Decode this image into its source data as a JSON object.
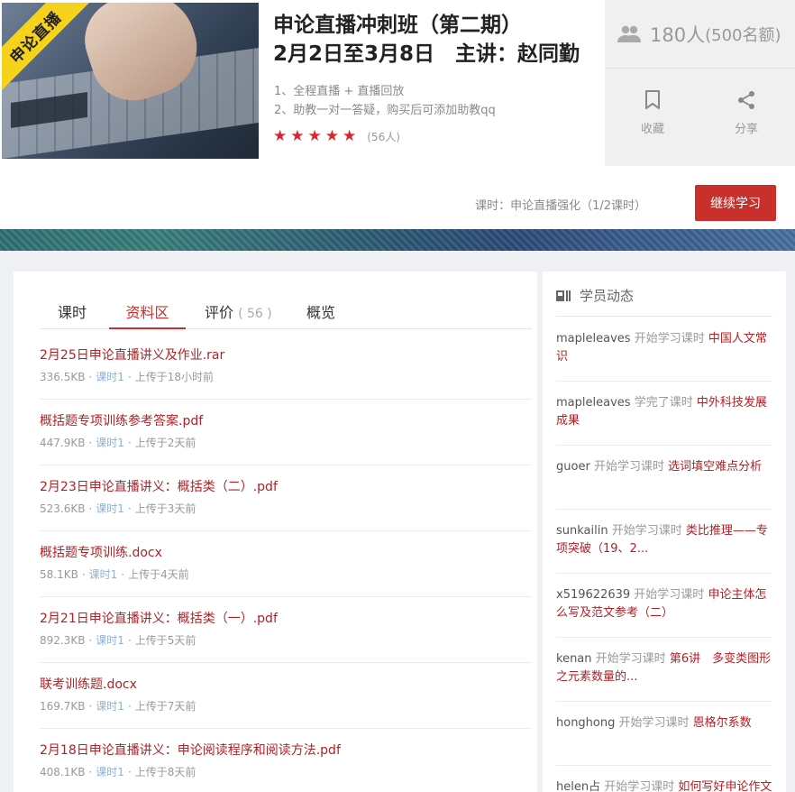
{
  "course": {
    "ribbon": "申论直播",
    "title_line1": "申论直播冲刺班（第二期）",
    "title_line2": "2月2日至3月8日　主讲：赵同勤",
    "features": [
      "1、全程直播 + 直播回放",
      "2、助教一对一答疑，购买后可添加助教qq"
    ],
    "rating_stars": 5,
    "rating_count": "(56人)",
    "enrolled": "180人",
    "quota": "(500名额)",
    "favorite_label": "收藏",
    "share_label": "分享"
  },
  "progress": {
    "text": "课时：申论直播强化（1/2课时）",
    "continue_label": "继续学习"
  },
  "colors": {
    "accent": "#c9302c",
    "link": "#b32025",
    "star": "#d9272d",
    "ribbon": "#f6d21c"
  },
  "tabs": [
    {
      "label": "课时"
    },
    {
      "label": "资料区"
    },
    {
      "label": "评价",
      "count": "( 56 )"
    },
    {
      "label": "概览"
    }
  ],
  "files": [
    {
      "name": "2月25日申论直播讲义及作业.rar",
      "size": "336.5KB",
      "lesson": "课时1",
      "uploaded": "上传于18小时前"
    },
    {
      "name": "概括题专项训练参考答案.pdf",
      "size": "447.9KB",
      "lesson": "课时1",
      "uploaded": "上传于2天前"
    },
    {
      "name": "2月23日申论直播讲义：概括类（二）.pdf",
      "size": "523.6KB",
      "lesson": "课时1",
      "uploaded": "上传于3天前"
    },
    {
      "name": "概括题专项训练.docx",
      "size": "58.1KB",
      "lesson": "课时1",
      "uploaded": "上传于4天前"
    },
    {
      "name": "2月21日申论直播讲义：概括类（一）.pdf",
      "size": "892.3KB",
      "lesson": "课时1",
      "uploaded": "上传于5天前"
    },
    {
      "name": "联考训练题.docx",
      "size": "169.7KB",
      "lesson": "课时1",
      "uploaded": "上传于7天前"
    },
    {
      "name": "2月18日申论直播讲义：申论阅读程序和阅读方法.pdf",
      "size": "408.1KB",
      "lesson": "课时1",
      "uploaded": "上传于8天前"
    }
  ],
  "activity": {
    "title": "学员动态",
    "items": [
      {
        "user": "mapleleaves",
        "verb": "开始学习课时",
        "course": "中国人文常识"
      },
      {
        "user": "mapleleaves",
        "verb": "学完了课时",
        "course": "中外科技发展成果"
      },
      {
        "user": "guoer",
        "verb": "开始学习课时",
        "course": "选词填空难点分析"
      },
      {
        "user": "sunkailin",
        "verb": "开始学习课时",
        "course": "类比推理——专项突破（19、2..."
      },
      {
        "user": "x519622639",
        "verb": "开始学习课时",
        "course": "申论主体怎么写及范文参考（二）"
      },
      {
        "user": "kenan",
        "verb": "开始学习课时",
        "course": "第6讲　多变类图形之元素数量的..."
      },
      {
        "user": "honghong",
        "verb": "开始学习课时",
        "course": "恩格尔系数"
      },
      {
        "user": "helen占",
        "verb": "开始学习课时",
        "course": "如何写好申论作文"
      }
    ]
  }
}
